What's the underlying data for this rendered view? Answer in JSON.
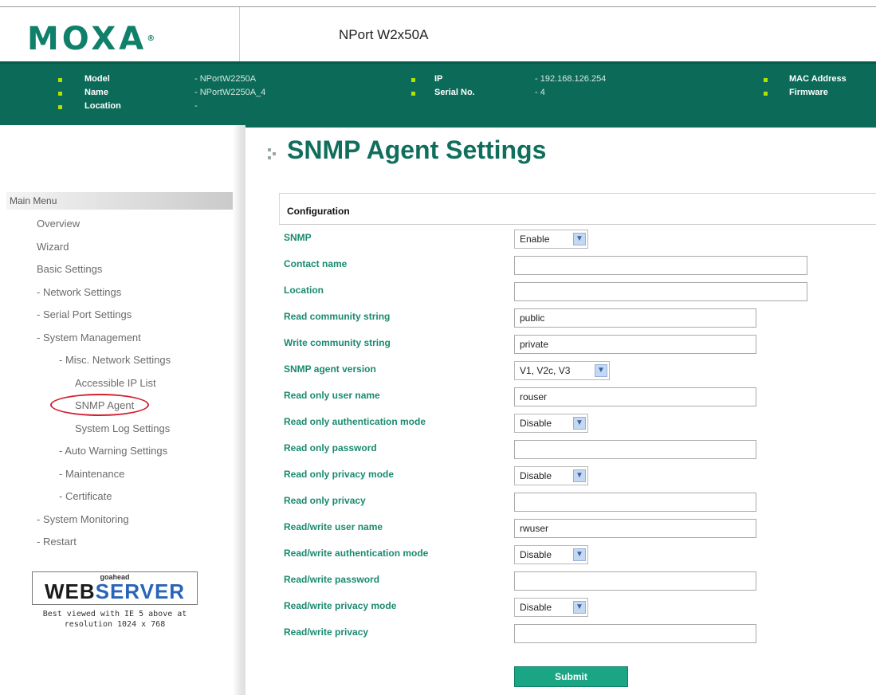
{
  "header": {
    "logo_text": "MOXA",
    "logo_mark": "®",
    "product_name": "NPort W2x50A"
  },
  "info_bar": {
    "model_label": "Model",
    "model_value": "- NPortW2250A",
    "name_label": "Name",
    "name_value": "- NPortW2250A_4",
    "location_label": "Location",
    "location_value": "-",
    "ip_label": "IP",
    "ip_value": "- 192.168.126.254",
    "serial_label": "Serial No.",
    "serial_value": "- 4",
    "mac_label": "MAC Address",
    "firmware_label": "Firmware"
  },
  "sidebar": {
    "menu_title": "Main Menu",
    "items": [
      "Overview",
      "Wizard",
      "Basic Settings",
      "- Network Settings",
      "- Serial Port Settings",
      "- System Management",
      "- Misc. Network Settings",
      "Accessible IP List",
      "SNMP Agent",
      "System Log Settings",
      "- Auto Warning Settings",
      "- Maintenance",
      "- Certificate",
      "- System Monitoring",
      "- Restart"
    ],
    "badge_top": "goahead",
    "badge_web": "WEB",
    "badge_server": "SERVER",
    "note_line1": "Best viewed with IE 5 above at",
    "note_line2": "resolution 1024 x 768"
  },
  "main": {
    "page_title": "SNMP Agent Settings",
    "section_title": "Configuration",
    "fields": [
      {
        "label": "SNMP",
        "type": "select",
        "value": "Enable"
      },
      {
        "label": "Contact name",
        "type": "text",
        "value": ""
      },
      {
        "label": "Location",
        "type": "text",
        "value": ""
      },
      {
        "label": "Read community string",
        "type": "text",
        "value": "public"
      },
      {
        "label": "Write community string",
        "type": "text",
        "value": "private"
      },
      {
        "label": "SNMP agent version",
        "type": "select",
        "value": "V1, V2c, V3"
      },
      {
        "label": "Read only user name",
        "type": "text",
        "value": "rouser"
      },
      {
        "label": "Read only authentication mode",
        "type": "select",
        "value": "Disable"
      },
      {
        "label": "Read only password",
        "type": "text",
        "value": ""
      },
      {
        "label": "Read only privacy mode",
        "type": "select",
        "value": "Disable"
      },
      {
        "label": "Read only privacy",
        "type": "text",
        "value": ""
      },
      {
        "label": "Read/write user name",
        "type": "text",
        "value": "rwuser"
      },
      {
        "label": "Read/write authentication mode",
        "type": "select",
        "value": "Disable"
      },
      {
        "label": "Read/write password",
        "type": "text",
        "value": ""
      },
      {
        "label": "Read/write privacy mode",
        "type": "select",
        "value": "Disable"
      },
      {
        "label": "Read/write privacy",
        "type": "text",
        "value": ""
      }
    ],
    "submit_label": "Submit"
  },
  "colors": {
    "brand_green": "#0b6b58",
    "title_green": "#0f6e5c",
    "label_green": "#1a8a6f",
    "button_green": "#1aa584",
    "highlight_red": "#d2202f"
  }
}
